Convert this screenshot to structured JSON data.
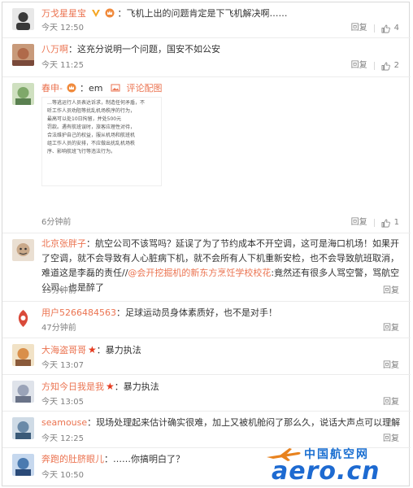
{
  "comments": [
    {
      "user": "万戈星星宝",
      "sep": "：",
      "text": "飞机上出的问题肯定是下飞机解决啊……",
      "time": "今天 12:50",
      "reply": "回复",
      "likes": "4",
      "avatar_color": "#3a3a3a"
    },
    {
      "user": "八万啊",
      "sep": "：",
      "text": "这充分说明一个问题，国安不如公安",
      "time": "今天 11:25",
      "reply": "回复",
      "likes": "2",
      "avatar_color": "#b06a4a"
    },
    {
      "user": "春申-",
      "sep": "：",
      "text": "em",
      "pic_link": "评论配图",
      "time": "6分钟前",
      "reply": "回复",
      "likes": "1",
      "avatar_color": "#7fa86a",
      "photo_lines": [
        "…等逃运行人员表达诉求，制造任何矛盾，不",
        "听工作人员劝阻等扰乱机场秩序的行为，",
        "最高可以处10日拘留，并处500元",
        "罚款。遇有航班误时，旅客应理性对待，",
        "合法维护自己的权益，服从机场和航班机",
        "组工作人员的安排，不应做出扰乱机场秩",
        "序、影响航班飞行等违法行为。"
      ]
    },
    {
      "user": "北京张胖子",
      "sep": "：",
      "text": "航空公司不该骂吗？延误了为了节约成本不开空调，这可是海口机场！如果开了空调，就不会导致有人心脏病下机，就不会所有人下机重新安检，也不会导致航班取消，难道这是李磊的责任//",
      "mention": "@会开挖掘机的新东方烹饪学校校花",
      "text_after": ":竟然还有很多人骂空警，骂航空公司。也是醉了",
      "time": "15分钟前",
      "reply": "回复",
      "avatar_color": "#c9a98a"
    },
    {
      "user": "用户5266484563",
      "sep": "：",
      "text": "足球运动员身体素质好，也不是对手！",
      "time": "47分钟前",
      "reply": "回复",
      "avatar_color": "#d94a3a"
    },
    {
      "user": "大海盗哥哥",
      "sep": "：",
      "text": "暴力执法",
      "time": "今天 13:07",
      "reply": "回复",
      "avatar_color": "#d98f4a"
    },
    {
      "user": "方知今日我是我",
      "sep": "：",
      "text": "暴力执法",
      "time": "今天 13:05",
      "reply": "回复",
      "avatar_color": "#9aa3b8"
    },
    {
      "user": "seamouse",
      "sep": "：",
      "text": "现场处理起来估计确实很难，加上又被机舱闷了那么久，说话大声点可以理解",
      "time": "今天 12:25",
      "reply": "回复",
      "avatar_color": "#6a8aa8"
    },
    {
      "user": "奔跑的肚脐眼儿",
      "sep": "：",
      "text": "……你搞明白了？",
      "time": "今天 10:50",
      "reply": "回复",
      "avatar_color": "#4a7ab0"
    }
  ],
  "watermark": {
    "cn": "中国航空网",
    "en": "aero.cn"
  },
  "colors": {
    "user": "#eb7350",
    "time": "#808080",
    "watermark": "#1d6ad1"
  }
}
